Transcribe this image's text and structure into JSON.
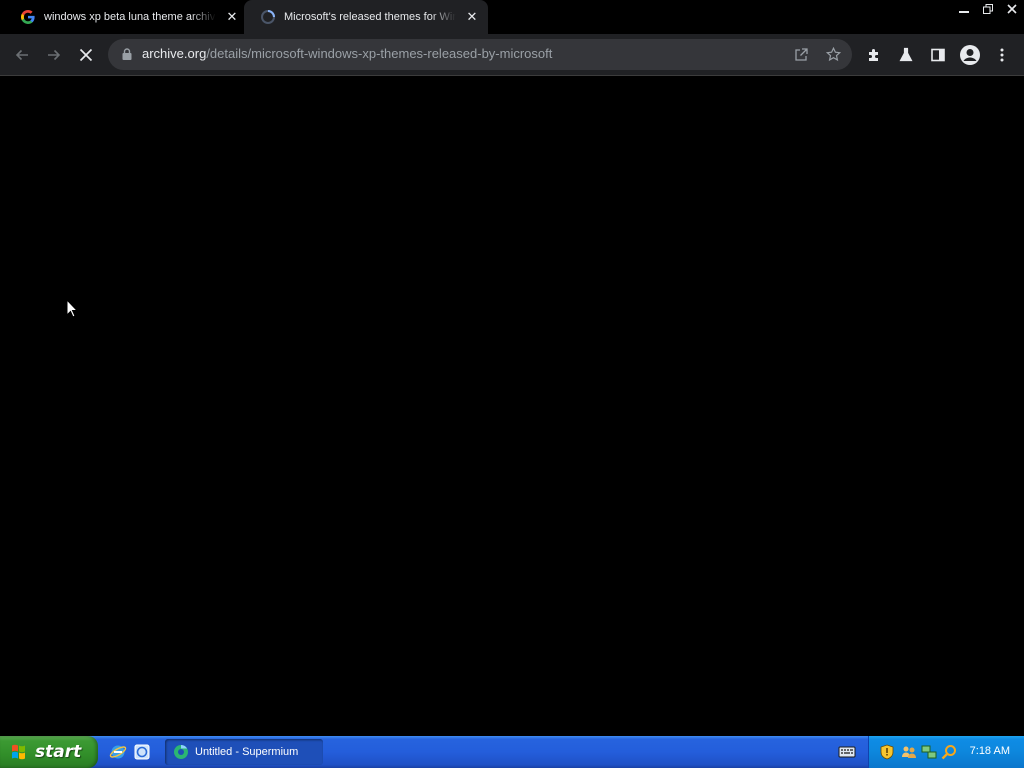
{
  "browser": {
    "tabs": [
      {
        "title": "windows xp beta luna theme archive",
        "icon": "google-g-icon",
        "active": false
      },
      {
        "title": "Microsoft's released themes for Windows XP",
        "icon": "loading-spinner-icon",
        "active": true
      }
    ],
    "window_controls": {
      "minimize": "minimize-icon",
      "restore": "restore-icon",
      "close": "close-icon"
    },
    "toolbar": {
      "back": "back-arrow-icon",
      "forward": "forward-arrow-icon",
      "stop": "stop-icon",
      "url_host": "archive.org",
      "url_path": "/details/microsoft-windows-xp-themes-released-by-microsoft",
      "share": "share-icon",
      "bookmark": "star-icon",
      "extensions": "puzzle-icon",
      "labs": "flask-icon",
      "side_panel": "side-panel-icon",
      "profile": "profile-icon",
      "menu": "kebab-menu-icon"
    }
  },
  "taskbar": {
    "start_label": "start",
    "quick_launch": [
      "internet-explorer-icon",
      "browser-icon"
    ],
    "tasks": [
      {
        "label": "Untitled - Supermium",
        "icon": "supermium-icon"
      }
    ],
    "tray_icons": [
      "keyboard-icon",
      "security-shield-icon",
      "users-icon",
      "network-icon",
      "search-icon"
    ],
    "clock": "7:18 AM"
  },
  "colors": {
    "content_bg": "#000000",
    "toolbar_bg": "#202124",
    "omnibox_bg": "#35363a",
    "taskbar_blue": "#245edb",
    "start_green": "#318e29",
    "tray_blue": "#0d87dd"
  }
}
